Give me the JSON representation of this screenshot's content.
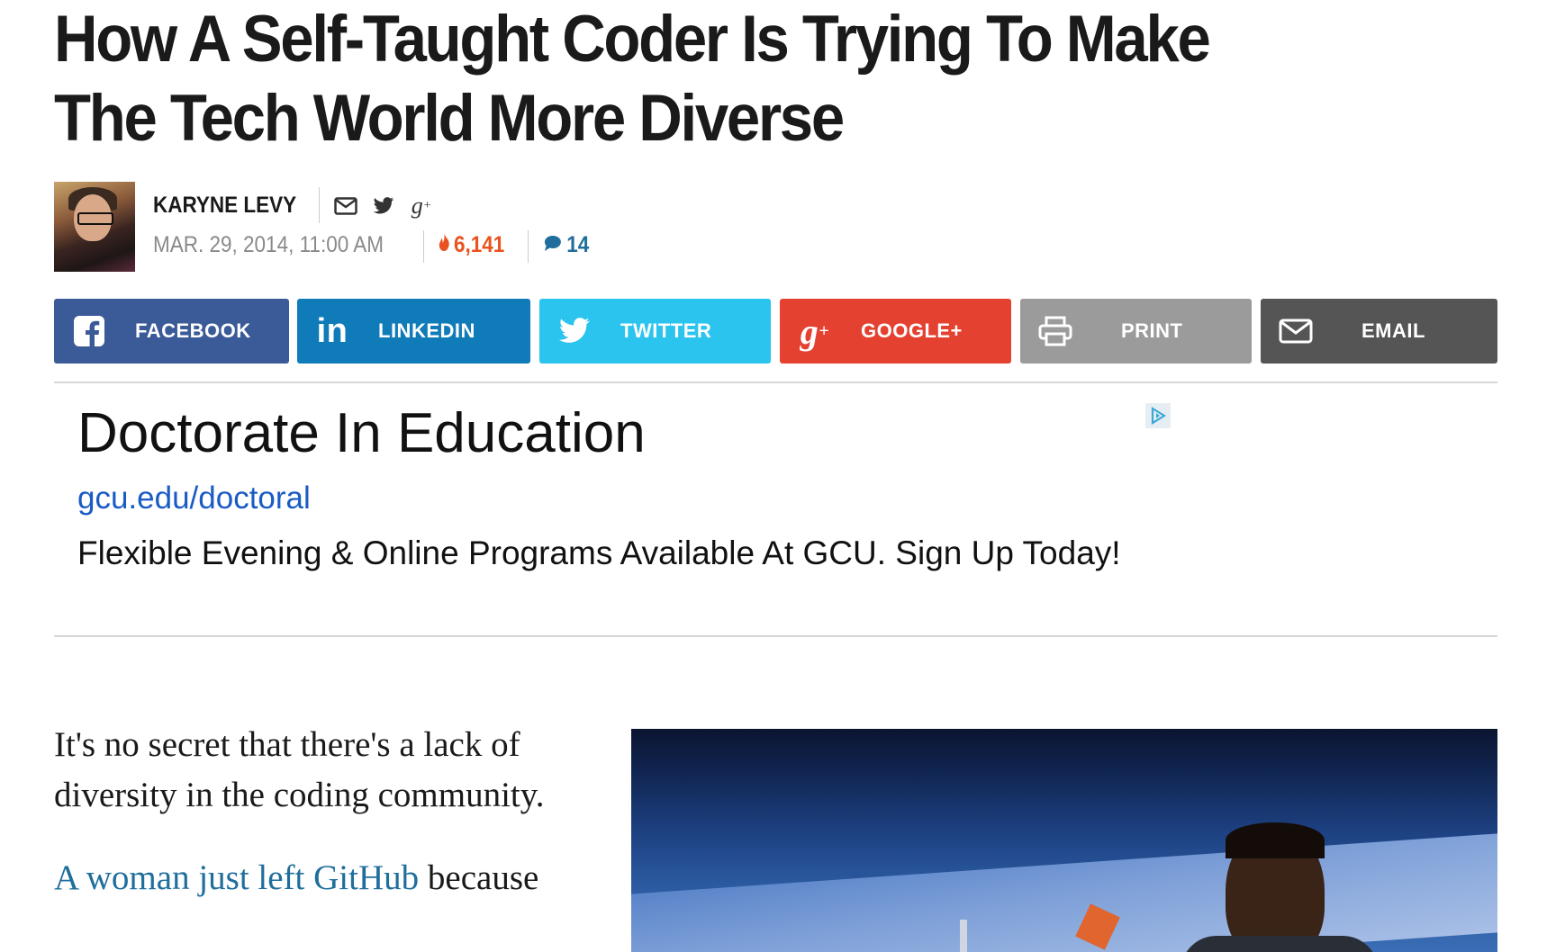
{
  "article": {
    "headline": "How A Self-Taught Coder Is Trying To Make The Tech World More Diverse",
    "author": "KARYNE LEVY",
    "date": "MAR. 29, 2014, 11:00 AM",
    "views": "6,141",
    "comments": "14"
  },
  "share": {
    "facebook": "FACEBOOK",
    "linkedin": "LINKEDIN",
    "twitter": "TWITTER",
    "google": "GOOGLE+",
    "print": "PRINT",
    "email": "EMAIL"
  },
  "ad": {
    "title": "Doctorate In Education",
    "url": "gcu.edu/doctoral",
    "description": "Flexible Evening & Online Programs Available At GCU. Sign Up Today!"
  },
  "body": {
    "p1": "It's no secret that there's a lack of diversity in the coding community.",
    "p2_link": "A woman just left GitHub",
    "p2_rest": " because"
  },
  "colors": {
    "facebook": "#3b5a98",
    "linkedin": "#0f7bb8",
    "twitter": "#2bc4ef",
    "google": "#e54130",
    "print": "#9b9b9b",
    "email": "#555555",
    "views": "#e9531f",
    "link": "#1f6e9c"
  },
  "icons": {
    "author": [
      "envelope-icon",
      "twitter-bird-icon",
      "google-plus-icon"
    ],
    "views": "flame-icon",
    "comments": "speech-bubble-icon",
    "ad": "ad-choices-icon"
  }
}
